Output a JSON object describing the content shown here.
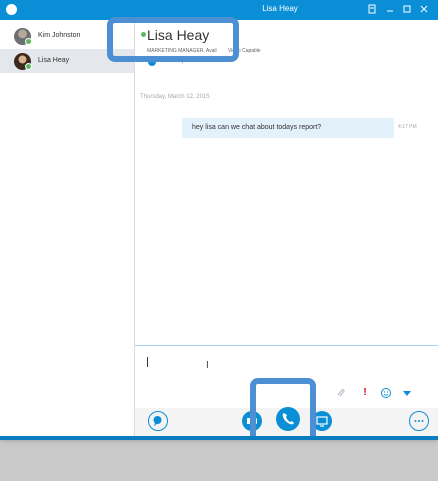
{
  "window": {
    "title": "Lisa Heay",
    "accent": "#0a8fd6",
    "controls": [
      "restore-icon",
      "minimize-icon",
      "maximize-icon",
      "close-icon"
    ]
  },
  "sidebar": {
    "contacts": [
      {
        "name": "Kim Johnston",
        "status": "online"
      },
      {
        "name": "Lisa Heay",
        "status": "online",
        "selected": true
      }
    ]
  },
  "conversation": {
    "contact_name": "Lisa Heay",
    "job_title": "MARKETING MANAGER, Avail",
    "capability": "Video Capable",
    "participants_label": "1 Participant"
  },
  "messages": {
    "date": "Thursday, March 12, 2015",
    "items": [
      {
        "text": "hey lisa can we chat about todays report?",
        "time": "4:17 PM"
      }
    ]
  },
  "compose": {
    "value": "",
    "icons": [
      "attach-icon",
      "priority-icon",
      "emoticon-icon",
      "dropdown-icon"
    ]
  },
  "call_bar": {
    "buttons": [
      "chat-icon",
      "video-icon",
      "phone-icon",
      "screen-share-icon",
      "more-options-icon"
    ]
  },
  "colors": {
    "presence_online": "#5cb85c",
    "highlight_box": "#4c8fd2",
    "bubble": "#e3f1fb"
  }
}
